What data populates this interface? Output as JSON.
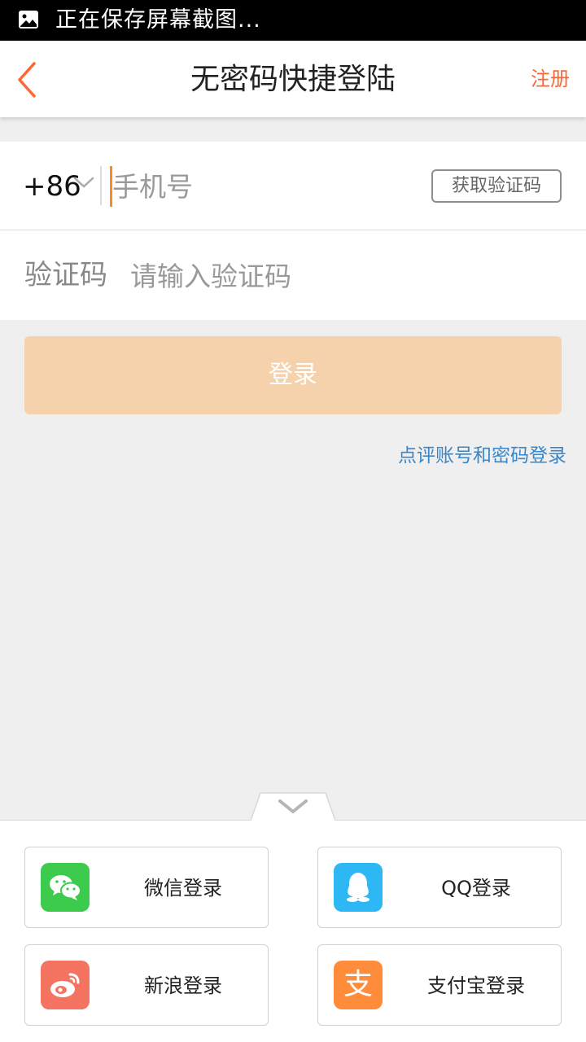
{
  "status_bar": {
    "text": "正在保存屏幕截图..."
  },
  "nav": {
    "title": "无密码快捷登陆",
    "register": "注册"
  },
  "form": {
    "country_code": "+86",
    "phone_placeholder": "手机号",
    "get_code": "获取验证码",
    "code_label": "验证码",
    "code_placeholder": "请输入验证码"
  },
  "login_button": "登录",
  "password_login": "点评账号和密码登录",
  "social": [
    {
      "label": "微信登录",
      "icon": "wechat-icon",
      "color": "#3ccb4c"
    },
    {
      "label": "QQ登录",
      "icon": "qq-icon",
      "color": "#2db7f5"
    },
    {
      "label": "新浪登录",
      "icon": "weibo-icon",
      "color": "#f47361"
    },
    {
      "label": "支付宝登录",
      "icon": "alipay-icon",
      "color": "#ff8c3a",
      "glyph": "支"
    }
  ],
  "colors": {
    "accent": "#ff6633",
    "caret": "#ff8c1a",
    "login_button_disabled": "#f5d2ac",
    "link": "#3a86c8"
  }
}
